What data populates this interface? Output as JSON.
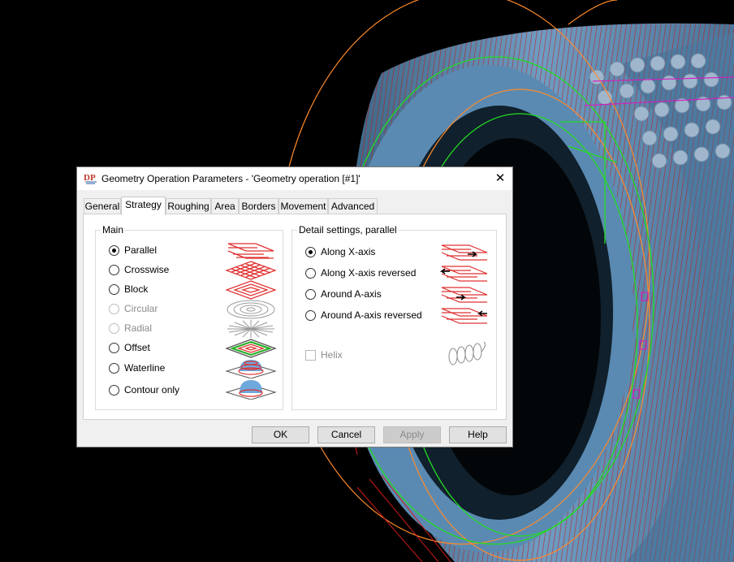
{
  "window": {
    "logo_text": "DP",
    "title": "Geometry Operation Parameters - 'Geometry operation [#1]'",
    "close_glyph": "✕"
  },
  "tabs": [
    {
      "label": "General"
    },
    {
      "label": "Strategy",
      "active": true
    },
    {
      "label": "Roughing"
    },
    {
      "label": "Area"
    },
    {
      "label": "Borders"
    },
    {
      "label": "Movement"
    },
    {
      "label": "Advanced"
    }
  ],
  "main_group": {
    "legend": "Main",
    "options": [
      {
        "label": "Parallel",
        "checked": true,
        "enabled": true,
        "icon": "parallel-pattern-icon"
      },
      {
        "label": "Crosswise",
        "checked": false,
        "enabled": true,
        "icon": "crosswise-pattern-icon"
      },
      {
        "label": "Block",
        "checked": false,
        "enabled": true,
        "icon": "block-pattern-icon"
      },
      {
        "label": "Circular",
        "checked": false,
        "enabled": false,
        "icon": "circular-pattern-icon"
      },
      {
        "label": "Radial",
        "checked": false,
        "enabled": false,
        "icon": "radial-pattern-icon"
      },
      {
        "label": "Offset",
        "checked": false,
        "enabled": true,
        "icon": "offset-pattern-icon"
      },
      {
        "label": "Waterline",
        "checked": false,
        "enabled": true,
        "icon": "waterline-pattern-icon"
      },
      {
        "label": "Contour only",
        "checked": false,
        "enabled": true,
        "icon": "contour-only-pattern-icon"
      }
    ]
  },
  "detail_group": {
    "legend": "Detail settings, parallel",
    "options": [
      {
        "label": "Along X-axis",
        "checked": true,
        "icon": "along-x-axis-icon"
      },
      {
        "label": "Along X-axis reversed",
        "checked": false,
        "icon": "along-x-axis-reversed-icon"
      },
      {
        "label": "Around A-axis",
        "checked": false,
        "icon": "around-a-axis-icon"
      },
      {
        "label": "Around A-axis reversed",
        "checked": false,
        "icon": "around-a-axis-reversed-icon"
      }
    ],
    "helix": {
      "label": "Helix",
      "checked": false,
      "enabled": false,
      "icon": "helix-icon"
    }
  },
  "buttons": {
    "ok": "OK",
    "cancel": "Cancel",
    "apply": "Apply",
    "help": "Help"
  },
  "colors": {
    "toolpath_red": "#d11a1a",
    "part_blue": "#5f8fb8",
    "contour_green": "#22dd22",
    "guide_orange": "#ff8a2a",
    "background": "#000000"
  }
}
